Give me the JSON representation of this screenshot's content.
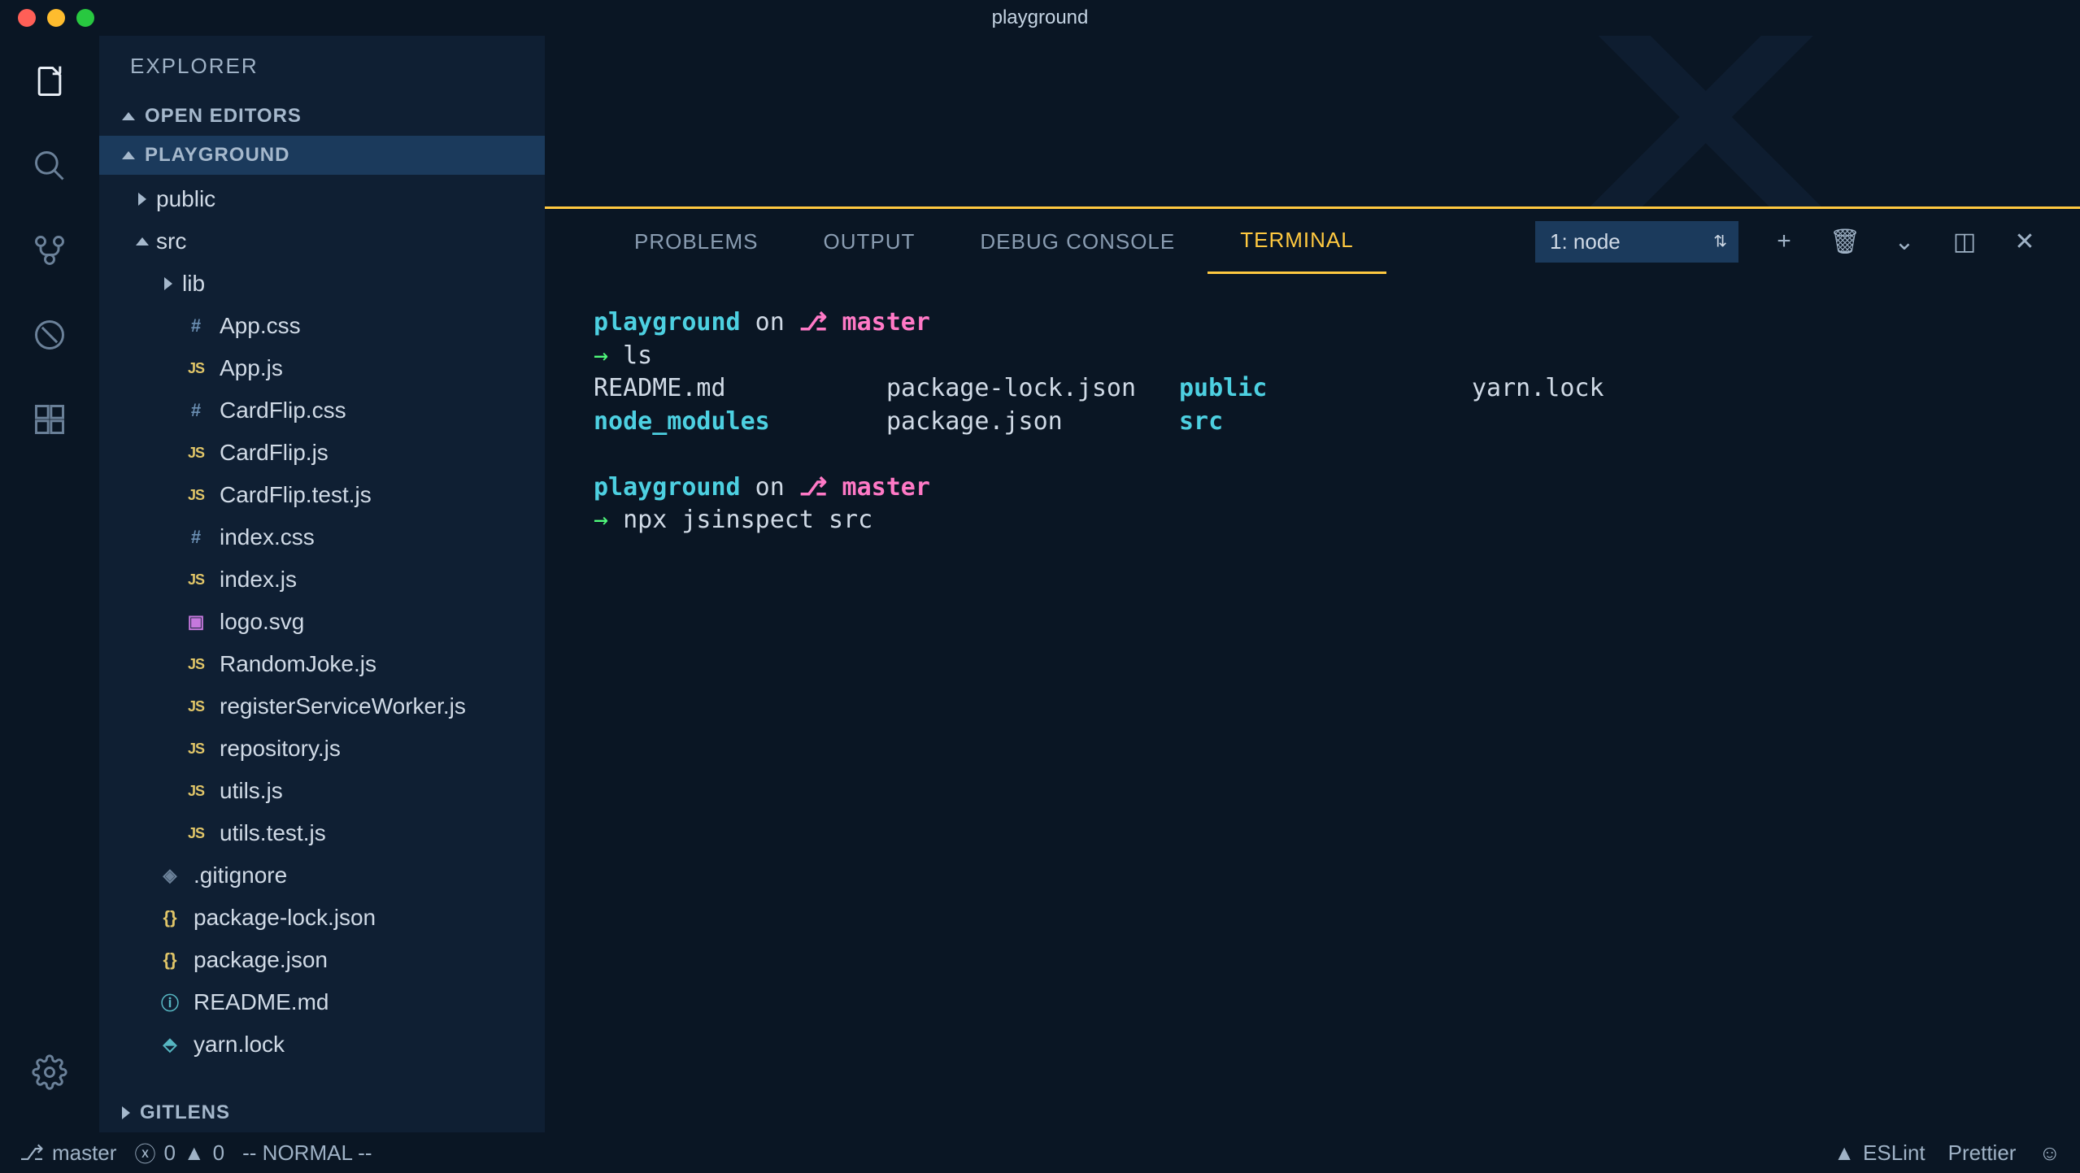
{
  "window": {
    "title": "playground"
  },
  "explorer": {
    "title": "EXPLORER",
    "sections": {
      "open_editors": "OPEN EDITORS",
      "workspace": "PLAYGROUND",
      "gitlens": "GITLENS"
    },
    "tree": [
      {
        "name": "public",
        "type": "folder",
        "expanded": false,
        "depth": 1
      },
      {
        "name": "src",
        "type": "folder",
        "expanded": true,
        "depth": 1
      },
      {
        "name": "lib",
        "type": "folder",
        "expanded": false,
        "depth": 2
      },
      {
        "name": "App.css",
        "type": "css",
        "depth": 2
      },
      {
        "name": "App.js",
        "type": "js",
        "depth": 2
      },
      {
        "name": "CardFlip.css",
        "type": "css",
        "depth": 2
      },
      {
        "name": "CardFlip.js",
        "type": "js",
        "depth": 2
      },
      {
        "name": "CardFlip.test.js",
        "type": "js",
        "depth": 2
      },
      {
        "name": "index.css",
        "type": "css",
        "depth": 2
      },
      {
        "name": "index.js",
        "type": "js",
        "depth": 2
      },
      {
        "name": "logo.svg",
        "type": "svg",
        "depth": 2
      },
      {
        "name": "RandomJoke.js",
        "type": "js",
        "depth": 2
      },
      {
        "name": "registerServiceWorker.js",
        "type": "js",
        "depth": 2
      },
      {
        "name": "repository.js",
        "type": "js",
        "depth": 2
      },
      {
        "name": "utils.js",
        "type": "js",
        "depth": 2
      },
      {
        "name": "utils.test.js",
        "type": "js",
        "depth": 2
      },
      {
        "name": ".gitignore",
        "type": "git",
        "depth": 1
      },
      {
        "name": "package-lock.json",
        "type": "json",
        "depth": 1
      },
      {
        "name": "package.json",
        "type": "json",
        "depth": 1
      },
      {
        "name": "README.md",
        "type": "info",
        "depth": 1
      },
      {
        "name": "yarn.lock",
        "type": "lock",
        "depth": 1
      }
    ]
  },
  "panel": {
    "tabs": {
      "problems": "PROBLEMS",
      "output": "OUTPUT",
      "debug": "DEBUG CONSOLE",
      "terminal": "TERMINAL"
    },
    "terminal_select": "1: node"
  },
  "terminal": {
    "prompt_dir": "playground",
    "prompt_on": " on ",
    "prompt_branch_glyph": "⎇",
    "prompt_branch": " master",
    "prompt_arrow": "→ ",
    "cmd1": "ls",
    "ls": {
      "r1c1": "README.md",
      "r1c2": "package-lock.json",
      "r1c3": "public",
      "r1c4": "yarn.lock",
      "r2c1": "node_modules",
      "r2c2": "package.json",
      "r2c3": "src"
    },
    "cmd2": "npx jsinspect src"
  },
  "statusbar": {
    "branch": "master",
    "errors": "0",
    "warnings": "0",
    "mode": "-- NORMAL --",
    "eslint": "ESLint",
    "prettier": "Prettier"
  }
}
